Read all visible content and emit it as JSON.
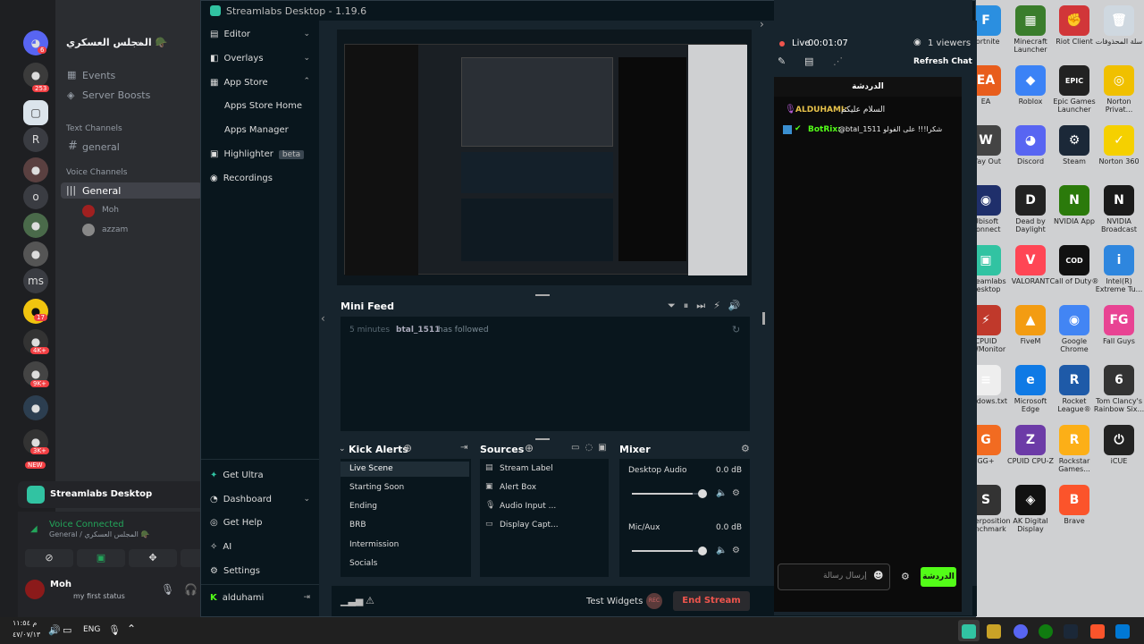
{
  "desktop": {
    "icons": [
      {
        "label": "Fortnite",
        "color": "#2b8fe0",
        "glyph": "F"
      },
      {
        "label": "Minecraft Launcher",
        "color": "#3a7d2c",
        "glyph": "▦"
      },
      {
        "label": "Riot Client",
        "color": "#d13639",
        "glyph": "✊"
      },
      {
        "label": "سلة المحذوفات",
        "color": "#cfd8e0",
        "glyph": "🗑"
      },
      {
        "label": "EA",
        "color": "#e85d1c",
        "glyph": "EA"
      },
      {
        "label": "Roblox",
        "color": "#3b82f6",
        "glyph": "◆"
      },
      {
        "label": "Epic Games Launcher",
        "color": "#222222",
        "glyph": "EPIC"
      },
      {
        "label": "Norton Privat...",
        "color": "#f0c000",
        "glyph": "◎"
      },
      {
        "label": "Way Out",
        "color": "#444444",
        "glyph": "W"
      },
      {
        "label": "Discord",
        "color": "#5865f2",
        "glyph": "◕"
      },
      {
        "label": "Steam",
        "color": "#1b2838",
        "glyph": "⚙"
      },
      {
        "label": "Norton 360",
        "color": "#f5d000",
        "glyph": "✓"
      },
      {
        "label": "Ubisoft Connect",
        "color": "#1f2f6b",
        "glyph": "◉"
      },
      {
        "label": "Dead by Daylight",
        "color": "#222222",
        "glyph": "D"
      },
      {
        "label": "NVIDIA App",
        "color": "#2b7a0b",
        "glyph": "N"
      },
      {
        "label": "NVIDIA Broadcast",
        "color": "#1a1a1a",
        "glyph": "N"
      },
      {
        "label": "Streamlabs Desktop",
        "color": "#31c3a2",
        "glyph": "▣"
      },
      {
        "label": "VALORANT",
        "color": "#ff4655",
        "glyph": "V"
      },
      {
        "label": "Call of Duty®",
        "color": "#111111",
        "glyph": "COD"
      },
      {
        "label": "Intel(R) Extreme Tu...",
        "color": "#2e86de",
        "glyph": "i"
      },
      {
        "label": "CPUID HWMonitor",
        "color": "#c0392b",
        "glyph": "⚡"
      },
      {
        "label": "FiveM",
        "color": "#f39c12",
        "glyph": "▲"
      },
      {
        "label": "Google Chrome",
        "color": "#4285f4",
        "glyph": "◉"
      },
      {
        "label": "Fall Guys",
        "color": "#e84393",
        "glyph": "FG"
      },
      {
        "label": "windows.txt",
        "color": "#eeeeee",
        "glyph": "≡"
      },
      {
        "label": "Microsoft Edge",
        "color": "#0f7ae5",
        "glyph": "e"
      },
      {
        "label": "Rocket League®",
        "color": "#1e5aa8",
        "glyph": "R"
      },
      {
        "label": "Tom Clancy's Rainbow Six...",
        "color": "#333333",
        "glyph": "6"
      },
      {
        "label": "GG+",
        "color": "#f26b21",
        "glyph": "G"
      },
      {
        "label": "CPUID CPU-Z",
        "color": "#6c3ba7",
        "glyph": "Z"
      },
      {
        "label": "Rockstar Games...",
        "color": "#fcaf17",
        "glyph": "R"
      },
      {
        "label": "iCUE",
        "color": "#222222",
        "glyph": "⏻"
      },
      {
        "label": "Superposition Benchmark",
        "color": "#333333",
        "glyph": "S"
      },
      {
        "label": "AK Digital Display",
        "color": "#111111",
        "glyph": "◈"
      },
      {
        "label": "Brave",
        "color": "#fb542b",
        "glyph": "B"
      }
    ]
  },
  "discord": {
    "server_name": "المجلس العسكري 🪖",
    "guild_badges": [
      "6",
      "253",
      "17",
      "4K+",
      "9K+",
      "3K+",
      "NEW"
    ],
    "guild_letters": [
      "R",
      "o",
      "ms"
    ],
    "events": "Events",
    "server_boosts": "Server Boosts",
    "text_channels": "Text Channels",
    "general_text": "general",
    "voice_channels": "Voice Channels",
    "general_voice": "General",
    "voice_users": [
      "Moh",
      "azzam"
    ],
    "app_banner": "Streamlabs Desktop",
    "voice_connected": "Voice Connected",
    "voice_location": "General / المجلس العسكري 🪖",
    "user_name": "Moh",
    "user_status": "my first status"
  },
  "streamlabs": {
    "title": "Streamlabs Desktop - 1.19.6",
    "nav": {
      "editor": "Editor",
      "overlays": "Overlays",
      "app_store": "App Store",
      "apps_store_home": "Apps Store Home",
      "apps_manager": "Apps Manager",
      "highlighter": "Highlighter",
      "beta": "beta",
      "recordings": "Recordings",
      "get_ultra": "Get Ultra",
      "dashboard": "Dashboard",
      "get_help": "Get Help",
      "ai": "AI",
      "settings": "Settings",
      "account": "alduhami"
    },
    "mini_feed": {
      "title": "Mini Feed",
      "time": "5 minutes",
      "user": "btal_1511",
      "action": "has followed"
    },
    "scenes": {
      "title": "Kick Alerts",
      "items": [
        "Live Scene",
        "Starting Soon",
        "Ending",
        "BRB",
        "Intermission",
        "Socials"
      ]
    },
    "sources": {
      "title": "Sources",
      "items": [
        "Stream Label",
        "Alert Box",
        "Audio Input ...",
        "Display Capt..."
      ]
    },
    "mixer": {
      "title": "Mixer",
      "channels": [
        {
          "name": "Desktop Audio",
          "db": "0.0 dB",
          "level": 0.87
        },
        {
          "name": "Mic/Aux",
          "db": "0.0 dB",
          "level": 0.87
        }
      ]
    },
    "footer": {
      "test_widgets": "Test Widgets",
      "rec": "REC",
      "end_stream": "End Stream"
    }
  },
  "chat": {
    "live_label": "Live",
    "live_time": "00:01:07",
    "viewers": "1 viewers",
    "refresh": "Refresh Chat",
    "header": "الدردشة",
    "messages": [
      {
        "user": "ALDUHAMI:",
        "text": "السلام عليكم",
        "color": "#e6c14a"
      },
      {
        "user": "BotRix:",
        "text": "@btal_1511 شكرا!!! على الفولو",
        "color": "#53fc18"
      }
    ],
    "input_placeholder": "إرسال رسالة",
    "send": "الدردشة"
  },
  "taskbar": {
    "lang": "ENG",
    "time": "م ١١:٥٤",
    "date": "٤٧/٠٧/١٣"
  }
}
